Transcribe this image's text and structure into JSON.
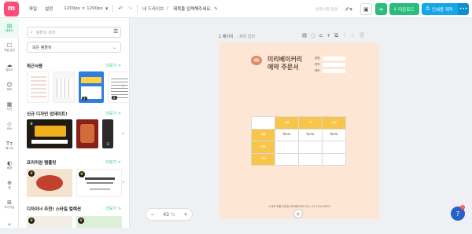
{
  "topbar": {
    "logo": "m",
    "menu_file": "파일",
    "menu_settings": "설정",
    "size": "1200px × 1200px",
    "crumb": "내 드라이브",
    "title": "제목을 입력해주세요.",
    "autosave": "변경사항 없음",
    "download": "다운로드",
    "print": "인쇄용 제작"
  },
  "leftnav": [
    {
      "icon": "▤",
      "label": "템플릿"
    },
    {
      "icon": "☐",
      "label": "작업 공간"
    },
    {
      "icon": "☁",
      "label": "업로드"
    },
    {
      "icon": "☺",
      "label": "포토"
    },
    {
      "icon": "▦",
      "label": "사진"
    },
    {
      "icon": "◇",
      "label": "요소"
    },
    {
      "icon": "Tт",
      "label": "텍스트"
    },
    {
      "icon": "◐",
      "label": "배경"
    },
    {
      "icon": "⊕",
      "label": "앱"
    },
    {
      "icon": "⊞",
      "label": "추가기능"
    }
  ],
  "panel": {
    "search_placeholder": "템플릿 검색",
    "select_value": "모든 템플릿",
    "sections": [
      {
        "title": "최근사용",
        "more": "더보기 >"
      },
      {
        "title": "신규 디자인 업데이트!",
        "more": "더보기 >"
      },
      {
        "title": "프리미엄 템플릿",
        "more": "더보기 >"
      },
      {
        "title": "디자이너 추천! 스타일 컬렉션",
        "more": "더보기 >"
      }
    ],
    "badges": [
      "2",
      "2",
      "3"
    ]
  },
  "canvas": {
    "page_label": "1 페이지",
    "page_sub": "- 제목 입력",
    "doc_title_line1": "미리베이커리",
    "doc_title_line2": "예약 주문서",
    "fields": [
      "성함",
      "연락",
      "메모"
    ],
    "table": {
      "headers": [
        "제품",
        "맛",
        "수량"
      ],
      "rows": [
        {
          "label": "제품",
          "cells": [
            "텍스트",
            "텍스트",
            "텍스트"
          ]
        },
        {
          "label": "메모",
          "cells": [
            "",
            "",
            ""
          ]
        },
        {
          "label": "기타",
          "cells": [
            "",
            "",
            ""
          ]
        }
      ]
    },
    "footer": "소규모 제빵 전문점 미리베이커리 주소, 02-1234-5678",
    "zoom": "43",
    "zoom_unit": "%"
  },
  "help_badge": "1",
  "colors": {
    "accent": "#2bbd7e",
    "print": "#14a6e6",
    "page_bg": "#fde6d4",
    "table_header": "#f7c54a"
  }
}
